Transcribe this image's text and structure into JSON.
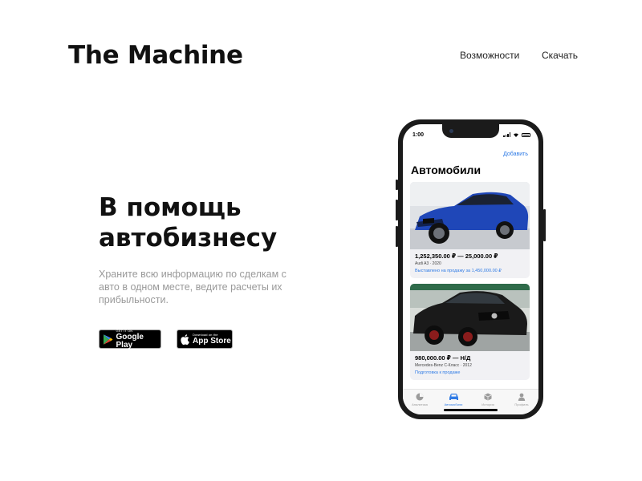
{
  "brand": {
    "name": "The Machine"
  },
  "nav": {
    "features": "Возможности",
    "download": "Скачать"
  },
  "hero": {
    "title_line1": "В помощь",
    "title_line2": "автобизнесу",
    "subtitle": "Храните всю информацию по сделкам с авто в одном месте, ведите расчеты их прибыльности."
  },
  "stores": {
    "google": {
      "small": "GET IT ON",
      "big": "Google Play",
      "icon": "google-play-icon"
    },
    "apple": {
      "small": "Download on the",
      "big": "App Store",
      "icon": "apple-icon"
    }
  },
  "phone": {
    "status_time": "1:00",
    "add_label": "Добавить",
    "title": "Автомобили",
    "cars": [
      {
        "price": "1,252,350.00 ₽ — 25,000.00 ₽",
        "model": "Audi A3 · 2020",
        "status": "Выставлено на продажу за 1,450,000.00 ₽",
        "color": "#1f47b8"
      },
      {
        "price": "980,000.00 ₽ — Н/Д",
        "model": "Mercedes-Benz С-Класс · 2012",
        "status": "Подготовка к продаже",
        "color": "#1a1a1a"
      }
    ],
    "tabs": [
      {
        "label": "Аналитика",
        "icon": "pie-chart-icon"
      },
      {
        "label": "Автомобили",
        "icon": "car-icon"
      },
      {
        "label": "История",
        "icon": "box-icon"
      },
      {
        "label": "Профиль",
        "icon": "person-icon"
      }
    ],
    "active_tab": "Автомобили",
    "accent": "#2f7be5"
  }
}
